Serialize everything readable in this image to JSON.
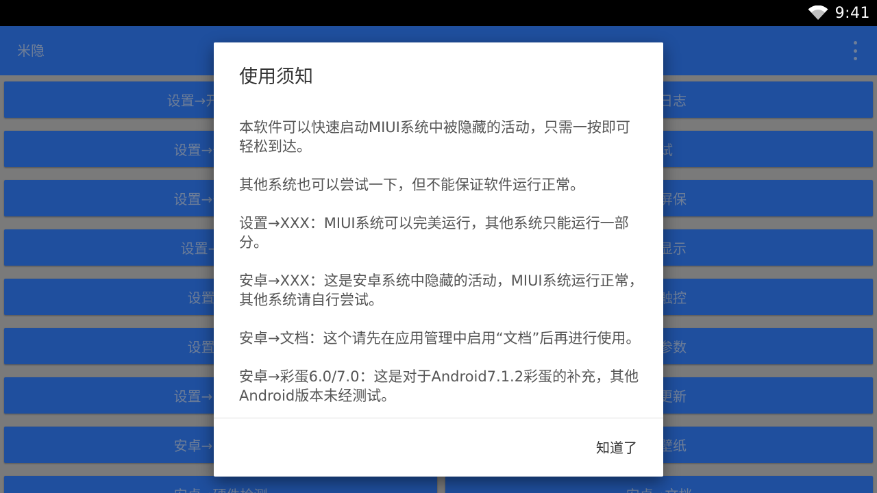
{
  "status_bar": {
    "time": "9:41",
    "icons": [
      "wifi-icon"
    ]
  },
  "app_bar": {
    "title": "米隐",
    "menu_icon": "overflow-menu-icon"
  },
  "grid": {
    "buttons": [
      "设置→开发者选项",
      "通知日志",
      "设置→开机自启",
      "测试",
      "设置→省电优化",
      "互动屏保",
      "设置→全面屏",
      "屏幕显示",
      "设置→按键",
      "边缘触控",
      "设置→其他",
      "GPS参数",
      "设置→系统更新",
      "系统更新",
      "安卓→隐藏设置",
      "动态壁纸",
      "安卓→硬件检测",
      "安卓→文档"
    ]
  },
  "dialog": {
    "title": "使用须知",
    "paragraphs": [
      "本软件可以快速启动MIUI系统中被隐藏的活动，只需一按即可轻松到达。",
      "其他系统也可以尝试一下，但不能保证软件运行正常。",
      "设置→XXX：MIUI系统可以完美运行，其他系统只能运行一部分。",
      "安卓→XXX：这是安卓系统中隐藏的活动，MIUI系统运行正常，其他系统请自行尝试。",
      "安卓→文档：这个请先在应用管理中启用“文档”后再进行使用。",
      "安卓→彩蛋6.0/7.0：这是对于Android7.1.2彩蛋的补充，其他Android版本未经测试。"
    ],
    "confirm_label": "知道了"
  },
  "colors": {
    "primary": "#1f4f9e",
    "status_bar": "#000000",
    "dialog_bg": "#ffffff"
  }
}
